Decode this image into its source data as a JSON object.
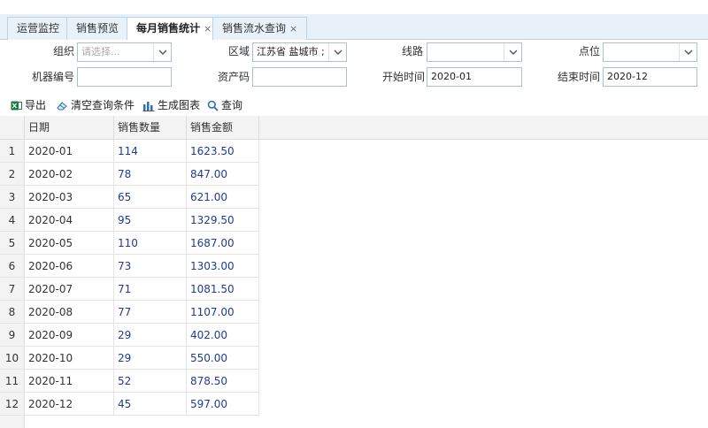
{
  "tabs": [
    {
      "label": "运营监控",
      "closable": false,
      "active": false
    },
    {
      "label": "销售预览",
      "closable": false,
      "active": false
    },
    {
      "label": "每月销售统计",
      "closable": true,
      "active": true
    },
    {
      "label": "销售流水查询",
      "closable": true,
      "active": false
    }
  ],
  "tab_close_glyph": "×",
  "form": {
    "org_label": "组织",
    "org_placeholder": "请选择...",
    "region_label": "区域",
    "region_value": "江苏省 盐城市 ;",
    "route_label": "线路",
    "route_value": "",
    "point_label": "点位",
    "point_value": "",
    "machine_label": "机器编号",
    "machine_value": "",
    "asset_label": "资产码",
    "asset_value": "",
    "start_label": "开始时间",
    "start_value": "2020-01",
    "end_label": "结束时间",
    "end_value": "2020-12"
  },
  "toolbar": {
    "export_label": "导出",
    "clear_label": "清空查询条件",
    "chart_label": "生成图表",
    "query_label": "查询"
  },
  "table": {
    "columns": [
      "日期",
      "销售数量",
      "销售金额"
    ],
    "rows": [
      {
        "num": "1",
        "date": "2020-01",
        "qty": "114",
        "amount": "1623.50"
      },
      {
        "num": "2",
        "date": "2020-02",
        "qty": "78",
        "amount": "847.00"
      },
      {
        "num": "3",
        "date": "2020-03",
        "qty": "65",
        "amount": "621.00"
      },
      {
        "num": "4",
        "date": "2020-04",
        "qty": "95",
        "amount": "1329.50"
      },
      {
        "num": "5",
        "date": "2020-05",
        "qty": "110",
        "amount": "1687.00"
      },
      {
        "num": "6",
        "date": "2020-06",
        "qty": "73",
        "amount": "1303.00"
      },
      {
        "num": "7",
        "date": "2020-07",
        "qty": "71",
        "amount": "1081.50"
      },
      {
        "num": "8",
        "date": "2020-08",
        "qty": "77",
        "amount": "1107.00"
      },
      {
        "num": "9",
        "date": "2020-09",
        "qty": "29",
        "amount": "402.00"
      },
      {
        "num": "10",
        "date": "2020-10",
        "qty": "29",
        "amount": "550.00"
      },
      {
        "num": "11",
        "date": "2020-11",
        "qty": "52",
        "amount": "878.50"
      },
      {
        "num": "12",
        "date": "2020-12",
        "qty": "45",
        "amount": "597.00"
      }
    ]
  },
  "colors": {
    "tabbar_bg": "#e8f1f9",
    "border": "#a9c1d6",
    "link_number": "#1f3b94",
    "excel_green": "#1e7b45",
    "icon_blue": "#2f6fb5"
  },
  "icons": {
    "export": "excel-icon",
    "clear": "eraser-icon",
    "chart": "bar-chart-icon",
    "query": "magnifier-icon",
    "dropdown": "chevron-down-icon"
  }
}
